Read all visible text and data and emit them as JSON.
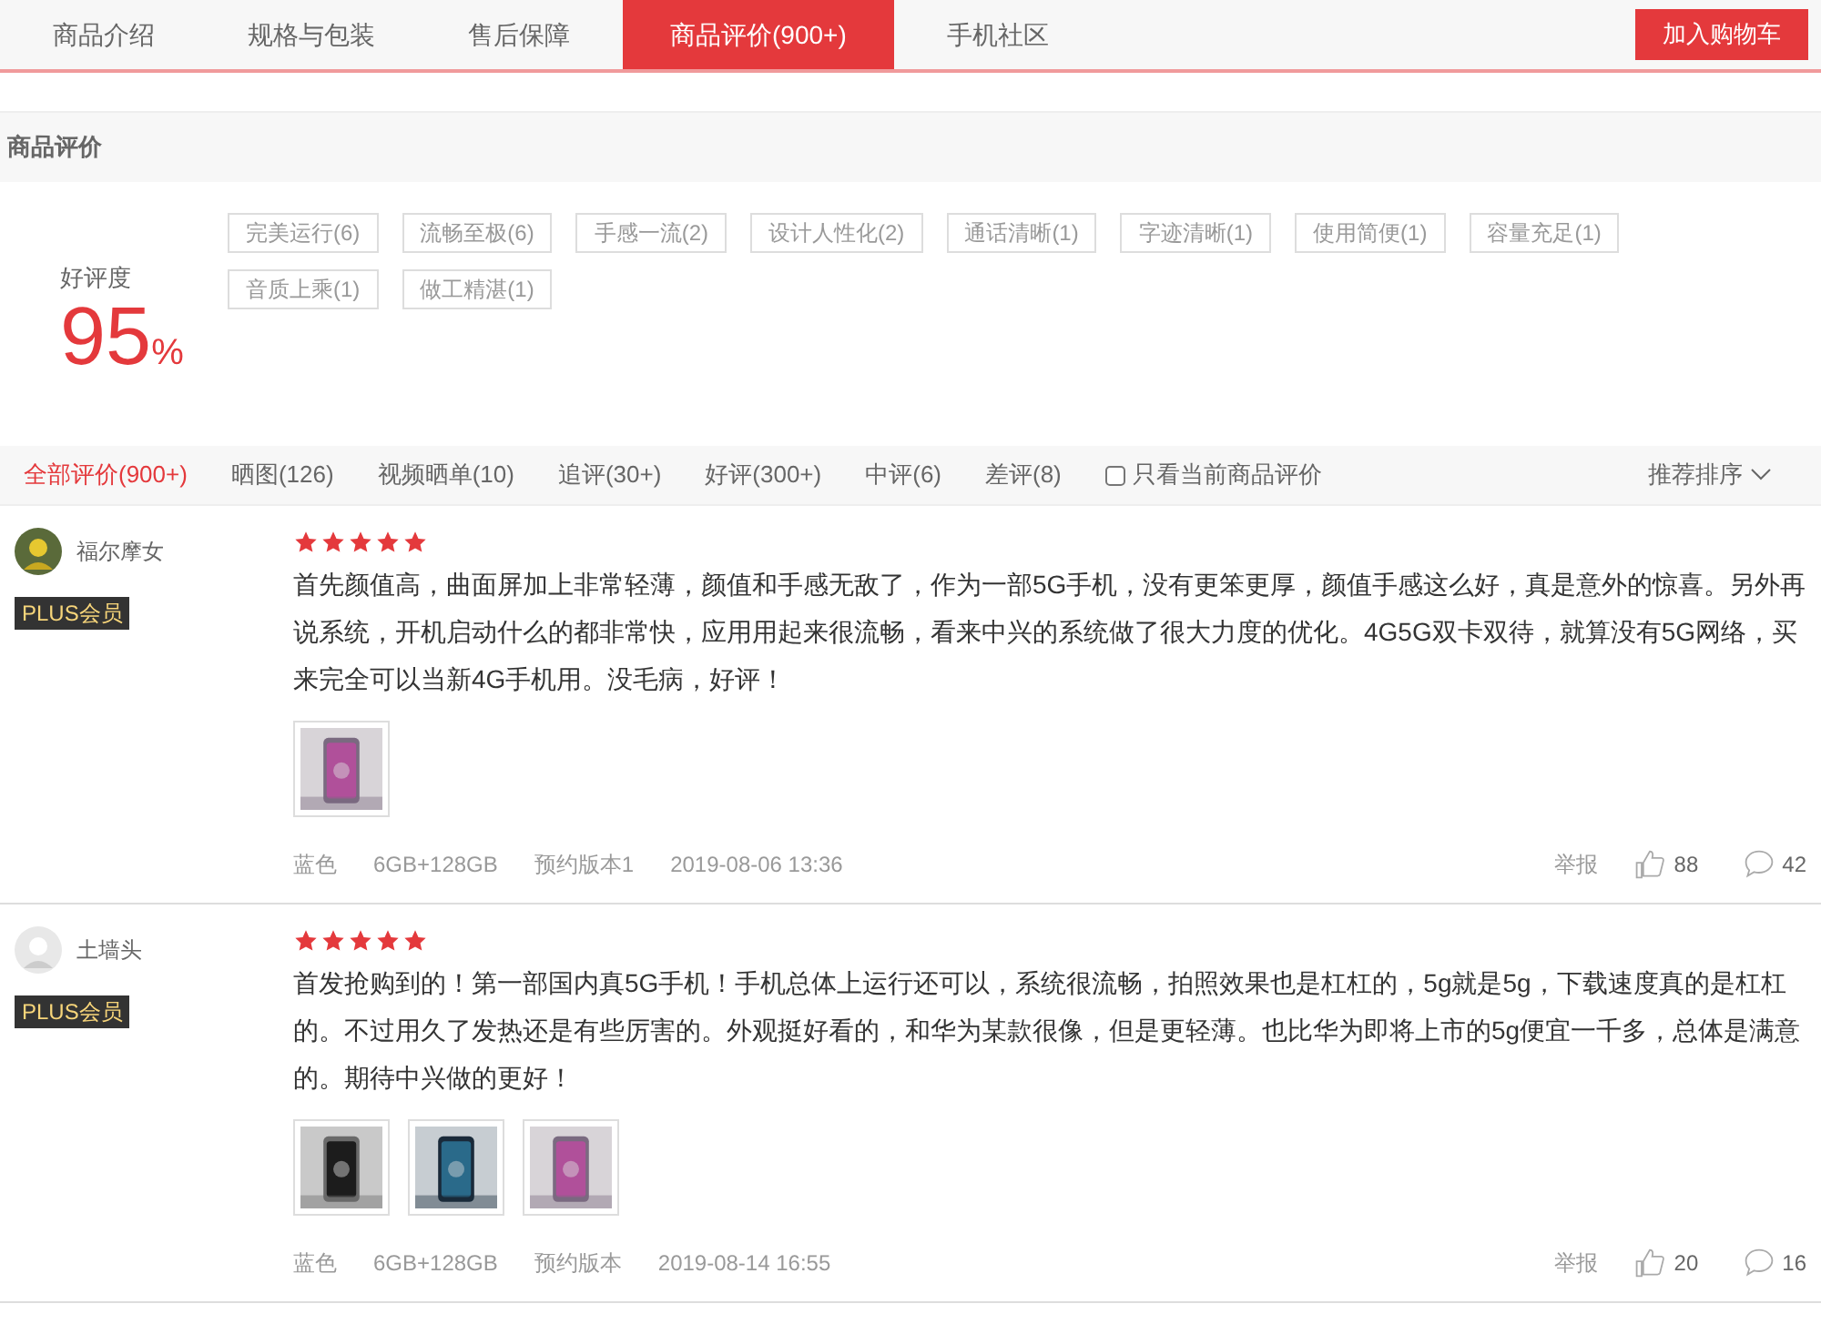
{
  "tabs": [
    {
      "label": "商品介绍",
      "selected": false
    },
    {
      "label": "规格与包装",
      "selected": false
    },
    {
      "label": "售后保障",
      "selected": false
    },
    {
      "label": "商品评价(900+)",
      "selected": true
    },
    {
      "label": "手机社区",
      "selected": false
    }
  ],
  "cart_button": "加入购物车",
  "section_title": "商品评价",
  "rating": {
    "label": "好评度",
    "value": "95",
    "unit": "%"
  },
  "tags": [
    "完美运行(6)",
    "流畅至极(6)",
    "手感一流(2)",
    "设计人性化(2)",
    "通话清晰(1)",
    "字迹清晰(1)",
    "使用简便(1)",
    "容量充足(1)",
    "音质上乘(1)",
    "做工精湛(1)"
  ],
  "filters": [
    {
      "label": "全部评价(900+)",
      "selected": true
    },
    {
      "label": "晒图(126)",
      "selected": false
    },
    {
      "label": "视频晒单(10)",
      "selected": false
    },
    {
      "label": "追评(30+)",
      "selected": false
    },
    {
      "label": "好评(300+)",
      "selected": false
    },
    {
      "label": "中评(6)",
      "selected": false
    },
    {
      "label": "差评(8)",
      "selected": false
    }
  ],
  "only_current": {
    "label": "只看当前商品评价",
    "checked": false
  },
  "sort": "推荐排序",
  "reviews": [
    {
      "user": "福尔摩女",
      "badge": "PLUS会员",
      "stars": 5,
      "text": "首先颜值高，曲面屏加上非常轻薄，颜值和手感无敌了，作为一部5G手机，没有更笨更厚，颜值手感这么好，真是意外的惊喜。另外再说系统，开机启动什么的都非常快，应用用起来很流畅，看来中兴的系统做了很大力度的优化。4G5G双卡双待，就算没有5G网络，买来完全可以当新4G手机用。没毛病，好评！",
      "photos": [
        {
          "kind": "picture"
        }
      ],
      "meta": [
        "蓝色",
        "6GB+128GB",
        "预约版本1",
        "2019-08-06 13:36"
      ],
      "report": "举报",
      "likes": "88",
      "comments": "42"
    },
    {
      "user": "土墙头",
      "badge": "PLUS会员",
      "stars": 5,
      "text": "首发抢购到的！第一部国内真5G手机！手机总体上运行还可以，系统很流畅，拍照效果也是杠杠的，5g就是5g，下载速度真的是杠杠的。不过用久了发热还是有些厉害的。外观挺好看的，和华为某款很像，但是更轻薄。也比华为即将上市的5g便宜一千多，总体是满意的。期待中兴做的更好！",
      "photos": [
        {
          "kind": "picture"
        },
        {
          "kind": "picture"
        },
        {
          "kind": "picture"
        }
      ],
      "meta": [
        "蓝色",
        "6GB+128GB",
        "预约版本",
        "2019-08-14 16:55"
      ],
      "report": "举报",
      "likes": "20",
      "comments": "16"
    }
  ]
}
